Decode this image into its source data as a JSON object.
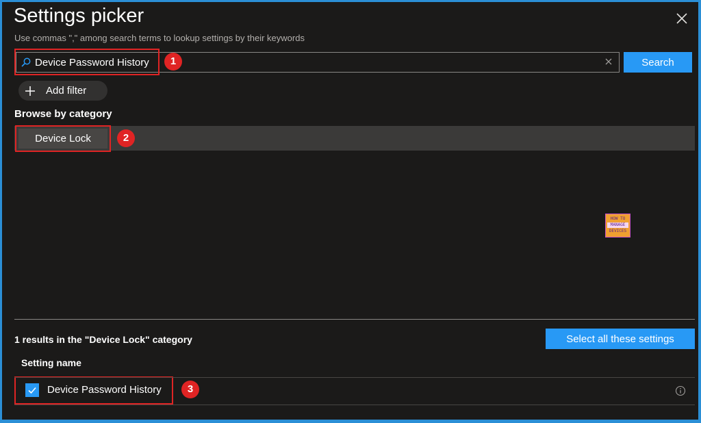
{
  "header": {
    "title": "Settings picker",
    "subtitle": "Use commas \",\" among search terms to lookup settings by their keywords",
    "close_icon": "close-icon"
  },
  "search": {
    "value": "Device Password History",
    "button_label": "Search",
    "search_icon": "search-icon",
    "clear_icon": "clear-icon"
  },
  "filter": {
    "add_label": "Add filter",
    "icon": "plus-icon"
  },
  "browse": {
    "label": "Browse by category",
    "categories": [
      {
        "label": "Device Lock"
      }
    ]
  },
  "annotations": {
    "badges": [
      "1",
      "2",
      "3"
    ],
    "color": "#e02424"
  },
  "logo": {
    "line1": "HOW TO",
    "line2": "MANAGE",
    "line3": "DEVICES"
  },
  "results": {
    "summary": "1 results in the \"Device Lock\" category",
    "select_all_label": "Select all these settings",
    "column_header": "Setting name",
    "rows": [
      {
        "label": "Device Password History",
        "checked": true,
        "info_icon": "info-icon"
      }
    ]
  },
  "colors": {
    "accent": "#2899f5",
    "panel_bg": "#1b1a19",
    "frame": "#2b8fd6"
  }
}
